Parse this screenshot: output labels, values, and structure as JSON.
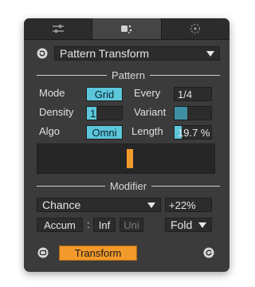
{
  "tabs": [
    {
      "icon": "sliders-icon",
      "active": false
    },
    {
      "icon": "dice-icon",
      "active": true
    },
    {
      "icon": "target-icon",
      "active": false
    }
  ],
  "header": {
    "transform_select": "Pattern Transform"
  },
  "pattern": {
    "section_label": "Pattern",
    "mode_label": "Mode",
    "mode_value": "Grid",
    "every_label": "Every",
    "every_value": "1/4",
    "density_label": "Density",
    "density_value": "1",
    "variant_label": "Variant",
    "variant_level": 0.35,
    "algo_label": "Algo",
    "algo_value": "Omni",
    "length_label": "Length",
    "length_value": "19.7 %",
    "length_level": 0.197
  },
  "modifier": {
    "section_label": "Modifier",
    "chance_select": "Chance",
    "chance_amount": "+22%",
    "accum_label": "Accum",
    "separator": ":",
    "inf_label": "Inf",
    "uni_label": "Uni",
    "fold_select": "Fold"
  },
  "footer": {
    "transform_button": "Transform"
  },
  "colors": {
    "accent_orange": "#f39a2c",
    "accent_cyan": "#5cc6db",
    "panel": "#3b3b3b"
  }
}
